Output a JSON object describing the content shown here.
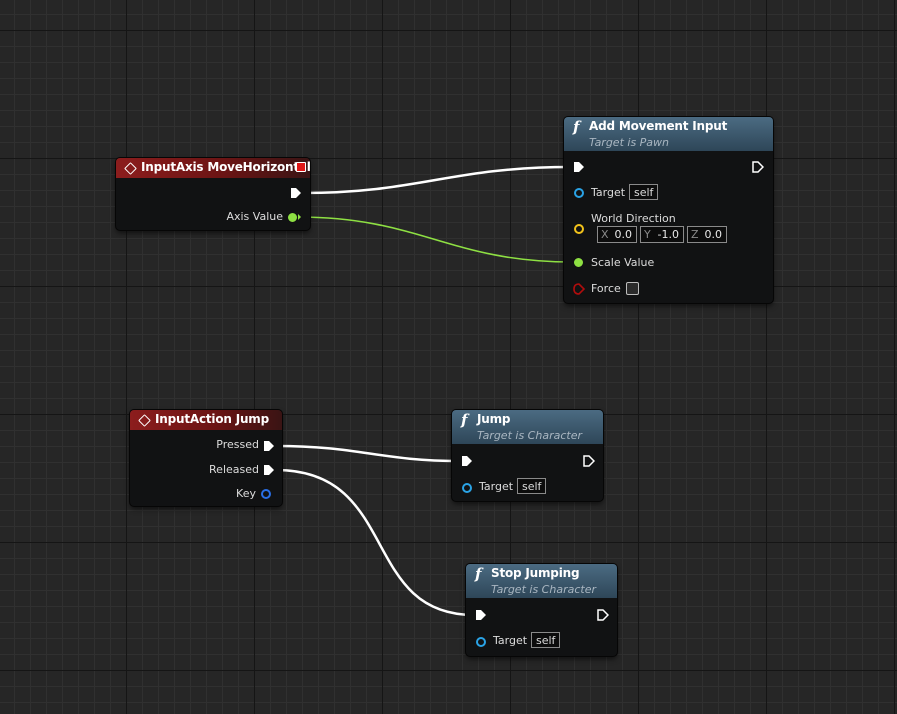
{
  "colors": {
    "exec_wire": "#ffffff",
    "float_wire": "#8ee043",
    "object_pin": "#2aa3e6",
    "vector_pin": "#f2c21b",
    "bool_pin": "#b00d0d",
    "event_header": "#8c1d1d",
    "function_header": "#3c5a70"
  },
  "nodes": {
    "input_axis": {
      "title": "InputAxis MoveHorizontal",
      "axis_value_label": "Axis Value"
    },
    "add_movement": {
      "title": "Add Movement Input",
      "subtitle": "Target is Pawn",
      "target_label": "Target",
      "target_value": "self",
      "world_direction_label": "World Direction",
      "x_axis": "X",
      "x_value": "0.0",
      "y_axis": "Y",
      "y_value": "-1.0",
      "z_axis": "Z",
      "z_value": "0.0",
      "scale_value_label": "Scale Value",
      "force_label": "Force"
    },
    "input_action": {
      "title": "InputAction Jump",
      "pressed_label": "Pressed",
      "released_label": "Released",
      "key_label": "Key"
    },
    "jump": {
      "title": "Jump",
      "subtitle": "Target is Character",
      "target_label": "Target",
      "target_value": "self"
    },
    "stop_jumping": {
      "title": "Stop Jumping",
      "subtitle": "Target is Character",
      "target_label": "Target",
      "target_value": "self"
    }
  }
}
